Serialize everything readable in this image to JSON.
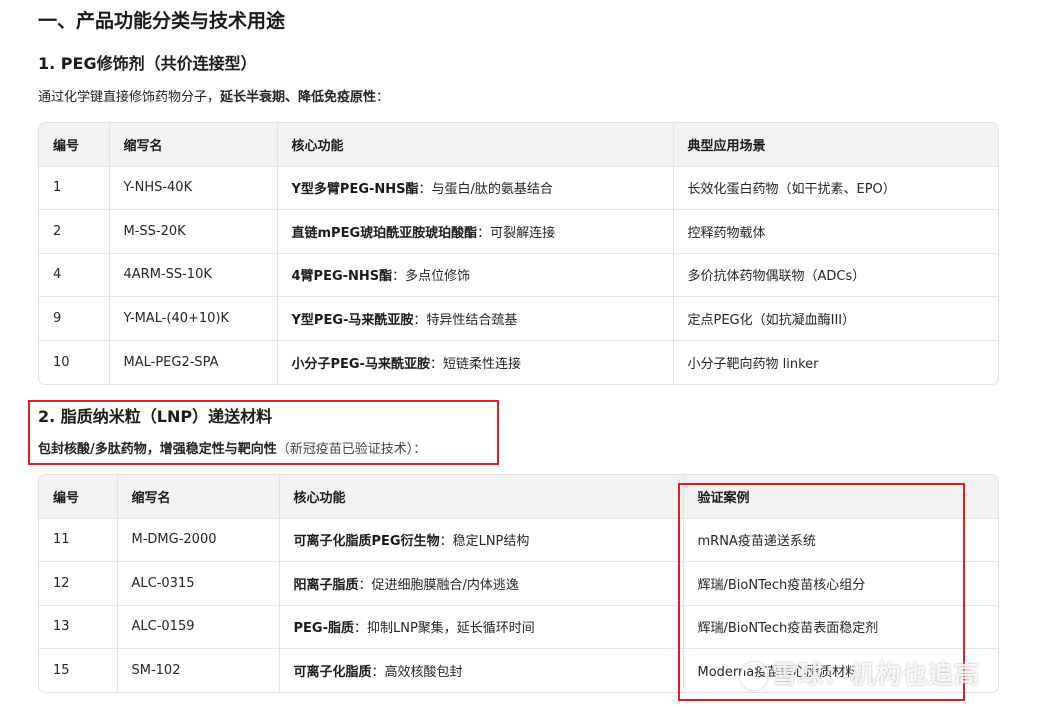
{
  "heading": "一、产品功能分类与技术用途",
  "section1": {
    "title": "1. PEG修饰剂（共价连接型）",
    "intro_plain": "通过化学键直接修饰药物分子，",
    "intro_bold": "延长半衰期、降低免疫原性",
    "intro_end": "：",
    "headers": [
      "编号",
      "缩写名",
      "核心功能",
      "典型应用场景"
    ],
    "rows": [
      {
        "no": "1",
        "abbr": "Y-NHS-40K",
        "func_bold": "Y型多臂PEG-NHS酯",
        "func_rest": "：与蛋白/肽的氨基结合",
        "app": "长效化蛋白药物（如干扰素、EPO）"
      },
      {
        "no": "2",
        "abbr": "M-SS-20K",
        "func_bold": "直链mPEG琥珀酰亚胺琥珀酸酯",
        "func_rest": "：可裂解连接",
        "app": "控释药物载体"
      },
      {
        "no": "4",
        "abbr": "4ARM-SS-10K",
        "func_bold": "4臂PEG-NHS酯",
        "func_rest": "：多点位修饰",
        "app": "多价抗体药物偶联物（ADCs）"
      },
      {
        "no": "9",
        "abbr": "Y-MAL-(40+10)K",
        "func_bold": "Y型PEG-马来酰亚胺",
        "func_rest": "：特异性结合巯基",
        "app": "定点PEG化（如抗凝血酶III）"
      },
      {
        "no": "10",
        "abbr": "MAL-PEG2-SPA",
        "func_bold": "小分子PEG-马来酰亚胺",
        "func_rest": "：短链柔性连接",
        "app": "小分子靶向药物 linker"
      }
    ]
  },
  "section2": {
    "title": "2. 脂质纳米粒（LNP）递送材料",
    "intro_bold": "包封核酸/多肽药物，增强稳定性与靶向性",
    "intro_plain": "（新冠疫苗已验证技术）：",
    "headers": [
      "编号",
      "缩写名",
      "核心功能",
      "验证案例"
    ],
    "rows": [
      {
        "no": "11",
        "abbr": "M-DMG-2000",
        "func_bold": "可离子化脂质PEG衍生物",
        "func_rest": "：稳定LNP结构",
        "app": "mRNA疫苗递送系统"
      },
      {
        "no": "12",
        "abbr": "ALC-0315",
        "func_bold": "阳离子脂质",
        "func_rest": "：促进细胞膜融合/内体逃逸",
        "app": "辉瑞/BioNTech疫苗核心组分"
      },
      {
        "no": "13",
        "abbr": "ALC-0159",
        "func_bold": "PEG-脂质",
        "func_rest": "：抑制LNP聚集，延长循环时间",
        "app": "辉瑞/BioNTech疫苗表面稳定剂"
      },
      {
        "no": "15",
        "abbr": "SM-102",
        "func_bold": "可离子化脂质",
        "func_rest": "：高效核酸包封",
        "app": "Moderna疫苗核心脂质材料"
      }
    ]
  },
  "watermark": "雪球：机构也追高",
  "colors": {
    "highlight_box": "#e02020",
    "header_bg": "#f2f2f2"
  }
}
